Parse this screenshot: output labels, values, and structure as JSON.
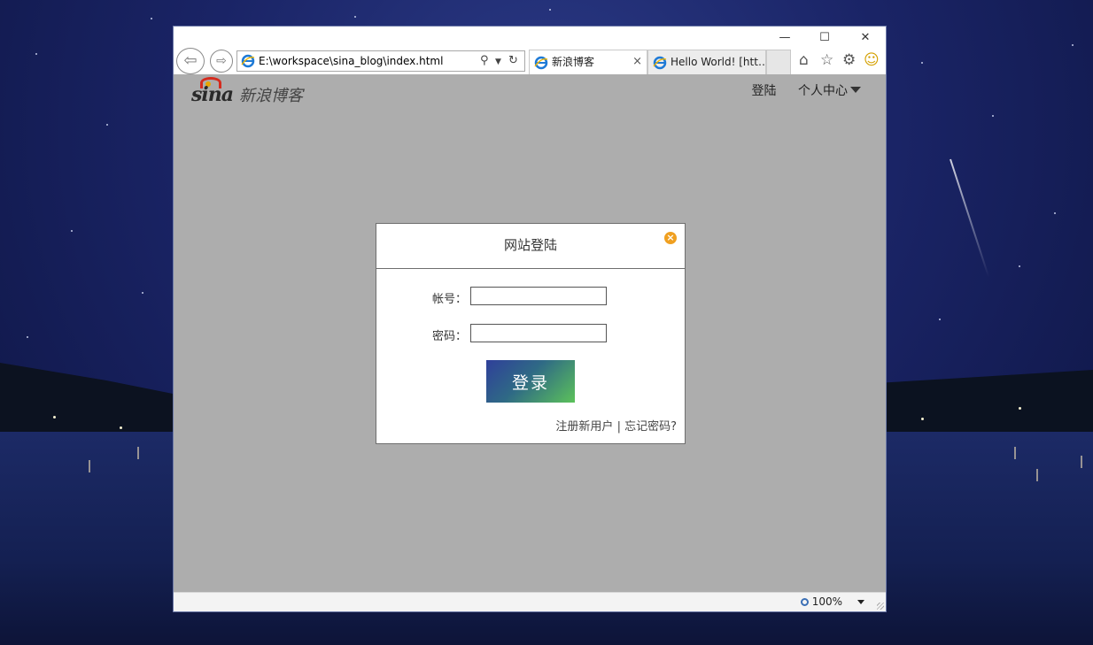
{
  "browser": {
    "address_url": "E:\\workspace\\sina_blog\\index.html",
    "tabs": [
      {
        "label": "新浪博客",
        "active": true
      },
      {
        "label": "Hello World! [htt…",
        "active": false
      }
    ],
    "tab_close_glyph": "×",
    "window_controls": {
      "minimize": "—",
      "maximize": "☐",
      "close": "✕"
    },
    "icons": {
      "back": "back-arrow-icon",
      "forward": "forward-arrow-icon",
      "search": "search-icon",
      "refresh": "refresh-icon",
      "home": "home-icon",
      "favorites": "star-icon",
      "settings": "gear-icon",
      "feedback": "smiley-icon"
    },
    "zoom_level": "100%"
  },
  "page": {
    "logo_text": "sina",
    "logo_cn": "新浪博客",
    "nav": {
      "login": "登陆",
      "personal_center": "个人中心"
    }
  },
  "dialog": {
    "title": "网站登陆",
    "close_glyph": "×",
    "account_label": "帐号：",
    "account_value": "",
    "password_label": "密码：",
    "password_value": "",
    "login_button": "登录",
    "register_link": "注册新用户",
    "separator": " | ",
    "forgot_link": "忘记密码?"
  },
  "colors": {
    "page_bg": "#adadad",
    "dialog_close": "#f0a020",
    "login_gradient_start": "#2f3f9a",
    "login_gradient_end": "#5cc25a"
  }
}
